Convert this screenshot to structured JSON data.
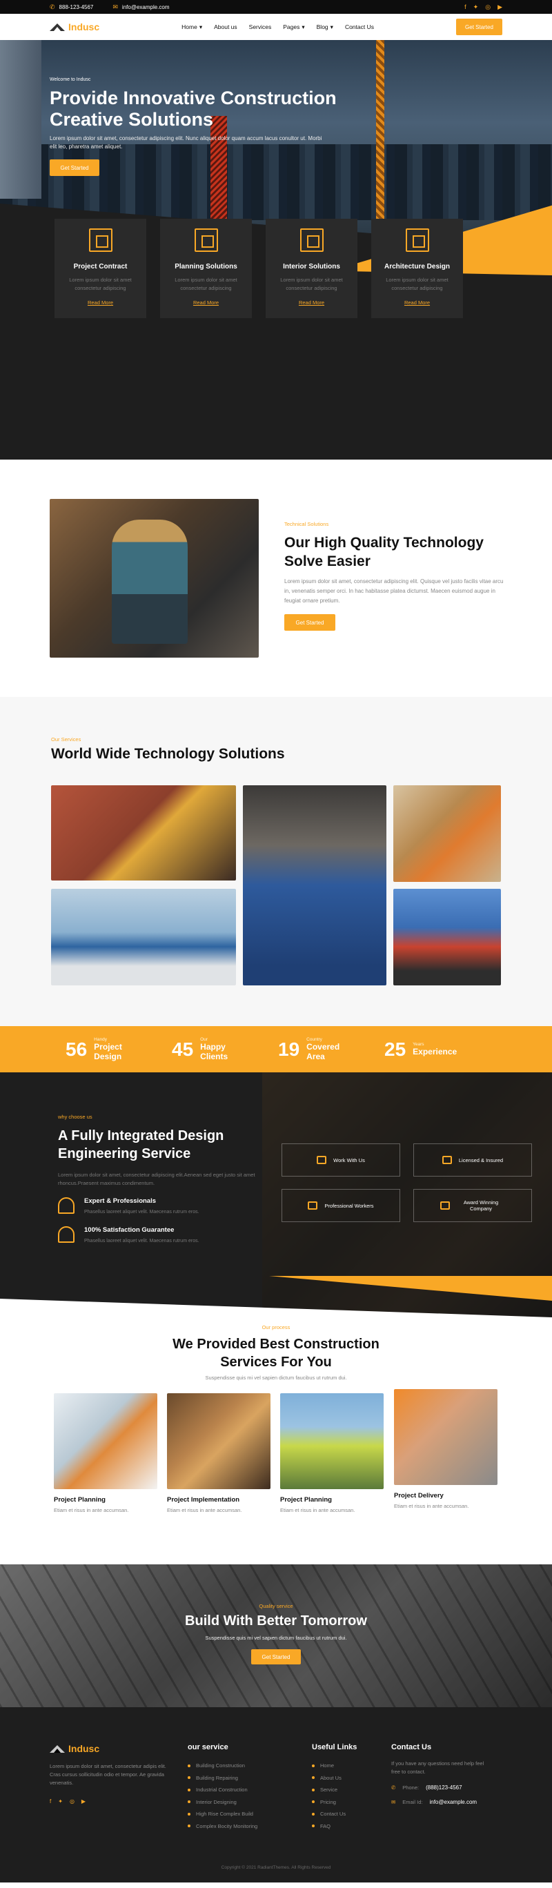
{
  "topbar": {
    "phone": "888-123-4567",
    "email": "info@example.com"
  },
  "brand": {
    "name": "Indusc",
    "accent": "#f9a826",
    "dark": "#1e1e1e"
  },
  "nav": {
    "items": [
      {
        "label": "Home"
      },
      {
        "label": "About us"
      },
      {
        "label": "Services"
      },
      {
        "label": "Pages"
      },
      {
        "label": "Blog"
      },
      {
        "label": "Contact Us"
      }
    ],
    "cta": "Get Started"
  },
  "hero": {
    "eyebrow": "Welcome to Indusc",
    "title": "Provide Innovative Construction Creative Solutions",
    "text": "Lorem ipsum dolor sit amet, consectetur adipiscing elit. Nunc aliquet dolor quam accum lacus conultor ut. Morbi elit leo, pharetra amet aliquet.",
    "button": "Get Started"
  },
  "features": [
    {
      "title": "Project Contract",
      "text": "Lorem ipsum dolor sit amet consectetur adipiscing",
      "link": "Read More"
    },
    {
      "title": "Planning Solutions",
      "text": "Lorem ipsum dolor sit amet consectetur adipiscing",
      "link": "Read More"
    },
    {
      "title": "Interior Solutions",
      "text": "Lorem ipsum dolor sit amet consectetur adipiscing",
      "link": "Read More"
    },
    {
      "title": "Architecture Design",
      "text": "Lorem ipsum dolor sit amet consectetur adipiscing",
      "link": "Read More"
    }
  ],
  "tech": {
    "eyebrow": "Technical Solutions",
    "title": "Our High Quality Technology Solve Easier",
    "text": "Lorem ipsum dolor sit amet, consectetur adipiscing elit. Quisque vel justo facilis vitae arcu in, venenatis semper orci. In hac habitasse platea dictumst. Maecen euismod augue in feugiat ornare pretium.",
    "button": "Get Started"
  },
  "services": {
    "eyebrow": "Our Services",
    "title": "World Wide Technology Solutions"
  },
  "counters": [
    {
      "num": "56",
      "small": "Handy",
      "label": "Project Design"
    },
    {
      "num": "45",
      "small": "Our",
      "label": "Happy Clients"
    },
    {
      "num": "19",
      "small": "Country",
      "label": "Covered Area"
    },
    {
      "num": "25",
      "small": "Years",
      "label": "Experience"
    }
  ],
  "integrated": {
    "eyebrow": "why choose us",
    "title": "A Fully Integrated Design Engineering Service",
    "text": "Lorem ipsum dolor sit amet, consectetur adipiscing elit.Aenean sed eget justo sit amet rhoncus.Praesent maximus condimentum.",
    "items": [
      {
        "title": "Expert & Professionals",
        "text": "Phasellus laoreet aliquet velit. Maecenas rutrum eros."
      },
      {
        "title": "100% Satisfaction Guarantee",
        "text": "Phasellus laoreet aliquet velit. Maecenas rutrum eros."
      }
    ],
    "boxes": [
      {
        "label": "Work With Us"
      },
      {
        "label": "Licensed & Insured"
      },
      {
        "label": "Professional Workers"
      },
      {
        "label": "Award Winning Company"
      }
    ]
  },
  "provided": {
    "eyebrow": "Our process",
    "title": "We Provided Best Construction Services For You",
    "sub": "Suspendisse quis mi vel sapien dictum faucibus ut rutrum dui.",
    "cards": [
      {
        "title": "Project Planning",
        "text": "Etiam et risus in ante accumsan."
      },
      {
        "title": "Project Implementation",
        "text": "Etiam et risus in ante accumsan."
      },
      {
        "title": "Project Planning",
        "text": "Etiam et risus in ante accumsan."
      },
      {
        "title": "Project Delivery",
        "text": "Etiam et risus in ante accumsan."
      }
    ]
  },
  "cta": {
    "eyebrow": "Quality service",
    "title": "Build With Better Tomorrow",
    "text": "Suspendisse quis mi vel sapien dictum faucibus ut rutrum dui.",
    "button": "Get Started"
  },
  "footer": {
    "about": "Lorem ipsum dolor sit amet, consectetur adipis elit. Cras cursus sollicitudin odio et tempor. Ae gravida venenatis.",
    "service_title": "our service",
    "services": [
      "Building Construction",
      "Building Repairing",
      "Industrial Construction",
      "Interior Designing",
      "High Rise Complex Build",
      "Complex Bocity Monitoring"
    ],
    "links_title": "Useful Links",
    "links": [
      "Home",
      "About Us",
      "Service",
      "Pricing",
      "Contact Us",
      "FAQ"
    ],
    "contact_title": "Contact Us",
    "contact_text": "If you have any questions need help feel free to contact.",
    "phone_label": "Phone:",
    "phone": "(888)123-4567",
    "email_label": "Email Id:",
    "email": "info@example.com",
    "copyright": "Copyright © 2021 RadiantThemes. All Rights Reserved"
  }
}
